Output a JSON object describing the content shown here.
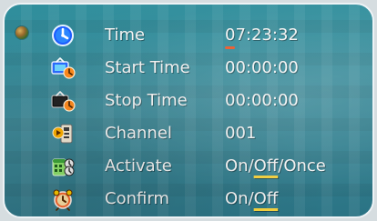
{
  "menu": {
    "items": [
      {
        "icon": "clock-icon",
        "label": "Time",
        "value": {
          "text": "07:23:32",
          "cursor_index": 0
        }
      },
      {
        "icon": "tv-clock-icon",
        "label": "Start Time",
        "value": {
          "text": "00:00:00"
        }
      },
      {
        "icon": "film-clock-icon",
        "label": "Stop Time",
        "value": {
          "text": "00:00:00"
        }
      },
      {
        "icon": "channel-icon",
        "label": "Channel",
        "value": {
          "text": "001"
        }
      },
      {
        "icon": "calendar-activate-icon",
        "label": "Activate",
        "value": {
          "options": [
            "On",
            "Off",
            "Once"
          ],
          "selected": "Off"
        }
      },
      {
        "icon": "alarm-clock-icon",
        "label": "Confirm",
        "value": {
          "options": [
            "On",
            "Off"
          ],
          "selected": "Off"
        }
      }
    ]
  },
  "colors": {
    "panel_bg": "#2a7f8f",
    "text": "#f2f2f2",
    "highlight_underline": "#f6d23f",
    "cursor_underline": "#e85b2d"
  }
}
